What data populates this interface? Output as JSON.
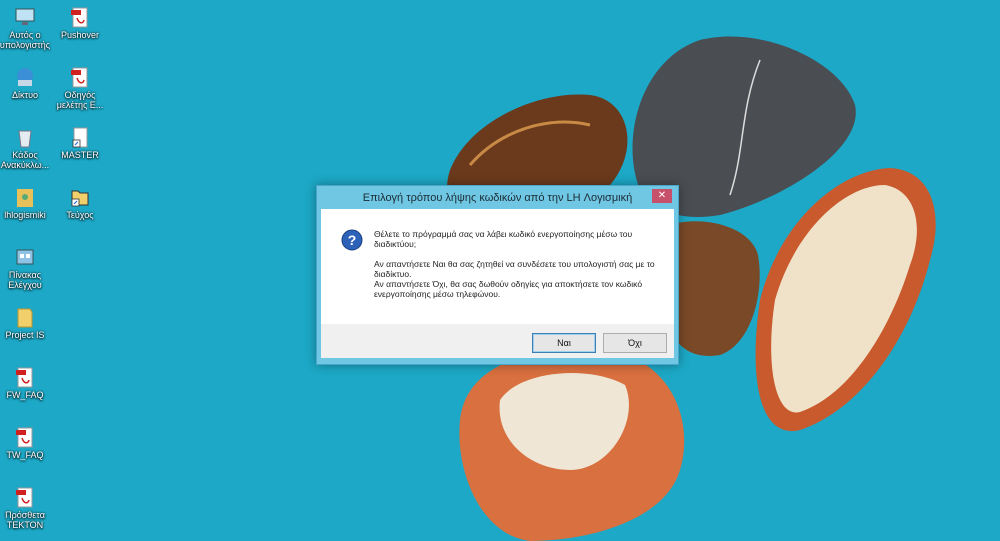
{
  "desktop": {
    "icons": [
      {
        "label": "Αυτός ο υπολογιστής",
        "icon": "computer-icon"
      },
      {
        "label": "Pushover",
        "icon": "pdf-file-icon"
      },
      {
        "label": "Δίκτυο",
        "icon": "network-icon"
      },
      {
        "label": "Οδηγός μελέτης Ε...",
        "icon": "pdf-file-icon"
      },
      {
        "label": "Κάδος Ανακύκλω...",
        "icon": "recycle-bin-icon"
      },
      {
        "label": "MASTER",
        "icon": "document-shortcut-icon"
      },
      {
        "label": "lhlogismiki",
        "icon": "user-folder-icon"
      },
      {
        "label": "Τεύχος",
        "icon": "folder-shortcut-icon"
      },
      {
        "label": "Πίνακας Ελέγχου",
        "icon": "control-panel-icon"
      },
      {
        "label": "Project IS",
        "icon": "folder-icon"
      },
      {
        "label": "FW_FAQ",
        "icon": "pdf-file-icon"
      },
      {
        "label": "TW_FAQ",
        "icon": "pdf-file-icon"
      },
      {
        "label": "Πρόσθετα TEKTON",
        "icon": "pdf-file-icon"
      }
    ]
  },
  "dialog": {
    "title": "Επιλογή τρόπου λήψης κωδικών από την LH Λογισμική",
    "close_label": "✕",
    "icon": "question-icon",
    "message_line1": "Θέλετε το πρόγραμμά σας να λάβει κωδικό ενεργοποίησης μέσω του διαδικτύου;",
    "message_line2": "Αν απαντήσετε Ναι θα σας ζητηθεί να συνδέσετε του υπολογιστή σας με το διαδίκτυο.",
    "message_line3": "Αν απαντήσετε Όχι, θα σας δωθούν οδηγίες για αποκτήσετε τον κωδικό ενεργοποίησης μέσω τηλεφώνου.",
    "yes_label": "Ναι",
    "no_label": "Όχι"
  },
  "colors": {
    "desktop_background": "#1ca8c6",
    "dialog_frame": "#70c7e4",
    "close_button": "#c7506a"
  }
}
